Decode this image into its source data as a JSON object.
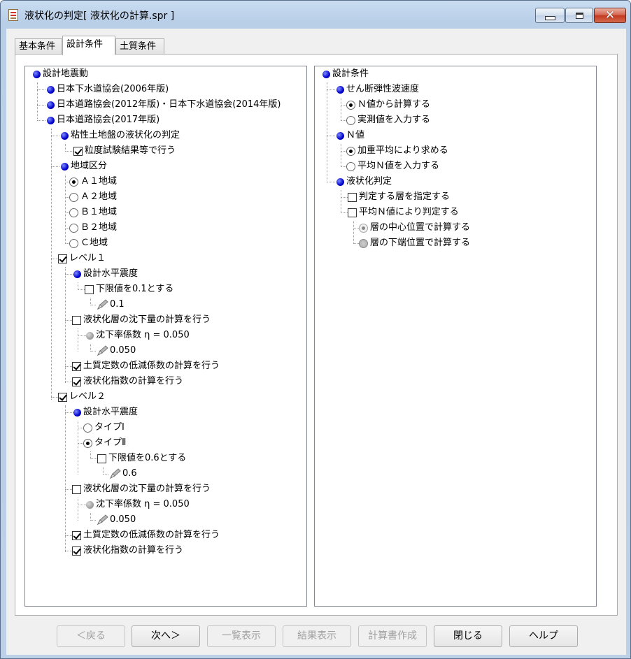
{
  "window": {
    "title": "液状化の判定[ 液状化の計算.spr ]"
  },
  "tabs": [
    {
      "label": "基本条件",
      "active": false
    },
    {
      "label": "設計条件",
      "active": true
    },
    {
      "label": "土質条件",
      "active": false
    }
  ],
  "left_tree": {
    "root": "設計地震動",
    "std1": "日本下水道協会(2006年版)",
    "std2": "日本道路協会(2012年版)・日本下水道協会(2014年版)",
    "std3": "日本道路協会(2017年版)",
    "viscous": "粘性土地盤の液状化の判定",
    "grain_test": "粒度試験結果等で行う",
    "region": "地域区分",
    "region_a1": "Ａ１地域",
    "region_a2": "Ａ２地域",
    "region_b1": "Ｂ１地域",
    "region_b2": "Ｂ２地域",
    "region_c": "Ｃ地域",
    "level1": {
      "label": "レベル１",
      "kh": "設計水平震度",
      "lower_limit": "下限値を0.1とする",
      "lower_value": "0.1",
      "settlement": "液状化層の沈下量の計算を行う",
      "settle_coef": "沈下率係数 η = 0.050",
      "settle_value": "0.050",
      "reduction": "土質定数の低減係数の計算を行う",
      "index": "液状化指数の計算を行う"
    },
    "level2": {
      "label": "レベル２",
      "kh": "設計水平震度",
      "type1": "タイプⅠ",
      "type2": "タイプⅡ",
      "lower_limit": "下限値を0.6とする",
      "lower_value": "0.6",
      "settlement": "液状化層の沈下量の計算を行う",
      "settle_coef": "沈下率係数 η = 0.050",
      "settle_value": "0.050",
      "reduction": "土質定数の低減係数の計算を行う",
      "index": "液状化指数の計算を行う"
    }
  },
  "right_tree": {
    "root": "設計条件",
    "shear": "せん断弾性波速度",
    "shear_from_n": "Ｎ値から計算する",
    "shear_measured": "実測値を入力する",
    "n_value": "Ｎ値",
    "n_weighted": "加重平均により求める",
    "n_input": "平均Ｎ値を入力する",
    "liq": "液状化判定",
    "liq_layer": "判定する層を指定する",
    "liq_avg_n": "平均Ｎ値により判定する",
    "liq_center": "層の中心位置で計算する",
    "liq_bottom": "層の下端位置で計算する"
  },
  "buttons": {
    "back": "＜戻る",
    "next": "次へ＞",
    "list": "一覧表示",
    "result": "結果表示",
    "report": "計算書作成",
    "close": "閉じる",
    "help": "ヘルプ"
  }
}
